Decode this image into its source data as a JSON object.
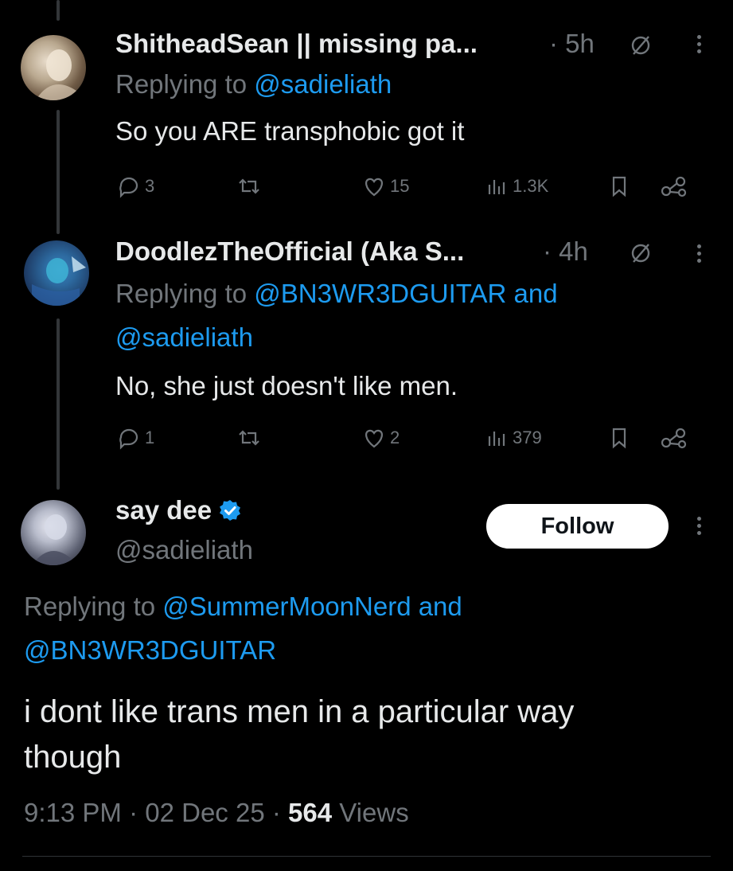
{
  "tweets": [
    {
      "name": "ShitheadSean || missing pa...",
      "time": "5h",
      "replying_prefix": "Replying to",
      "replying_handles": "@sadieliath",
      "text": "So you ARE transphobic got it",
      "replies": "3",
      "likes": "15",
      "views": "1.3K",
      "avatar_icon": "avatar-image"
    },
    {
      "name": "DoodlezTheOfficial (Aka S...",
      "time": "4h",
      "replying_prefix": "Replying to",
      "replying_line1": "@BN3WR3DGUITAR and",
      "replying_line2": "@sadieliath",
      "text": "No, she just doesn't like men.",
      "replies": "1",
      "likes": "2",
      "views": "379",
      "avatar_icon": "avatar-image"
    }
  ],
  "main_tweet": {
    "name": "say dee",
    "handle": "@sadieliath",
    "verified": true,
    "follow_label": "Follow",
    "replying_prefix": "Replying to",
    "replying_line1": "@SummerMoonNerd and",
    "replying_line2": "@BN3WR3DGUITAR",
    "text_line1": "i dont like trans men in a particular way",
    "text_line2": "though",
    "time": "9:13 PM",
    "date": "02 Dec 25",
    "views_count": "564",
    "views_label": "Views",
    "dot": "·"
  },
  "colors": {
    "background": "#000000",
    "text": "#e7e9ea",
    "muted": "#71767b",
    "link": "#1d9bf0",
    "verified": "#1d9bf0"
  }
}
